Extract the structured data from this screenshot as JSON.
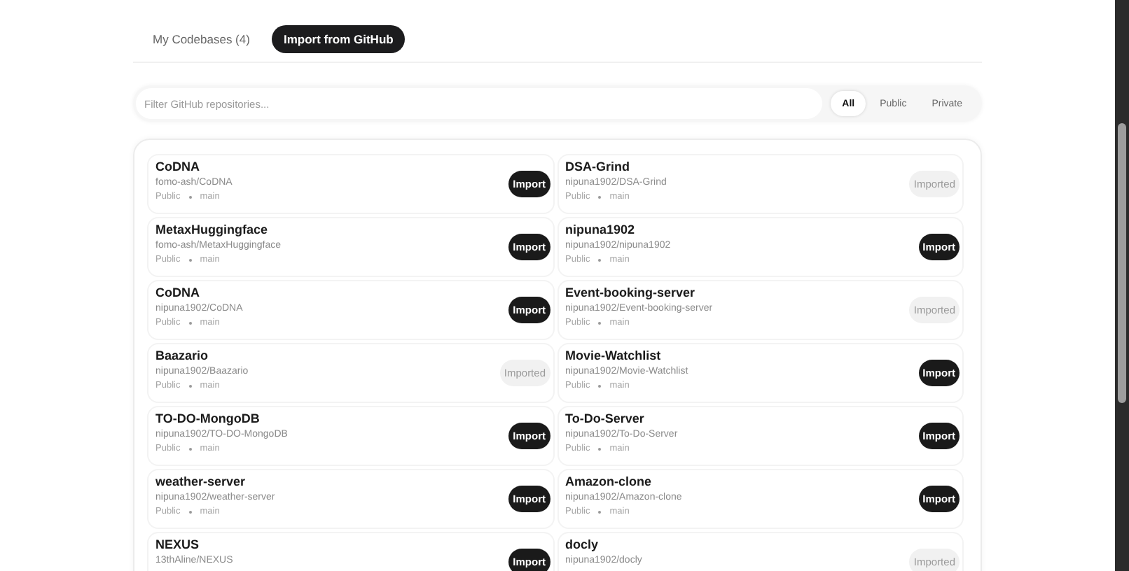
{
  "tabs": [
    {
      "label": "My Codebases (4)",
      "selected": false
    },
    {
      "label": "Import from GitHub",
      "selected": true
    }
  ],
  "filter": {
    "placeholder": "Filter GitHub repositories..."
  },
  "visibility_options": [
    {
      "label": "All",
      "selected": true
    },
    {
      "label": "Public",
      "selected": false
    },
    {
      "label": "Private",
      "selected": false
    }
  ],
  "repositories": [
    {
      "name": "CoDNA",
      "path": "fomo-ash/CoDNA",
      "visibility": "Public",
      "branch": "main",
      "action": "Import",
      "imported": false
    },
    {
      "name": "DSA-Grind",
      "path": "nipuna1902/DSA-Grind",
      "visibility": "Public",
      "branch": "main",
      "action": "Imported",
      "imported": true
    },
    {
      "name": "MetaxHuggingface",
      "path": "fomo-ash/MetaxHuggingface",
      "visibility": "Public",
      "branch": "main",
      "action": "Import",
      "imported": false
    },
    {
      "name": "nipuna1902",
      "path": "nipuna1902/nipuna1902",
      "visibility": "Public",
      "branch": "main",
      "action": "Import",
      "imported": false
    },
    {
      "name": "CoDNA",
      "path": "nipuna1902/CoDNA",
      "visibility": "Public",
      "branch": "main",
      "action": "Import",
      "imported": false
    },
    {
      "name": "Event-booking-server",
      "path": "nipuna1902/Event-booking-server",
      "visibility": "Public",
      "branch": "main",
      "action": "Imported",
      "imported": true
    },
    {
      "name": "Baazario",
      "path": "nipuna1902/Baazario",
      "visibility": "Public",
      "branch": "main",
      "action": "Imported",
      "imported": true
    },
    {
      "name": "Movie-Watchlist",
      "path": "nipuna1902/Movie-Watchlist",
      "visibility": "Public",
      "branch": "main",
      "action": "Import",
      "imported": false
    },
    {
      "name": "TO-DO-MongoDB",
      "path": "nipuna1902/TO-DO-MongoDB",
      "visibility": "Public",
      "branch": "main",
      "action": "Import",
      "imported": false
    },
    {
      "name": "To-Do-Server",
      "path": "nipuna1902/To-Do-Server",
      "visibility": "Public",
      "branch": "main",
      "action": "Import",
      "imported": false
    },
    {
      "name": "weather-server",
      "path": "nipuna1902/weather-server",
      "visibility": "Public",
      "branch": "main",
      "action": "Import",
      "imported": false
    },
    {
      "name": "Amazon-clone",
      "path": "nipuna1902/Amazon-clone",
      "visibility": "Public",
      "branch": "main",
      "action": "Import",
      "imported": false
    },
    {
      "name": "NEXUS",
      "path": "13thAline/NEXUS",
      "action": "Import",
      "imported": false
    },
    {
      "name": "docly",
      "path": "nipuna1902/docly",
      "action": "Imported",
      "imported": true
    }
  ]
}
